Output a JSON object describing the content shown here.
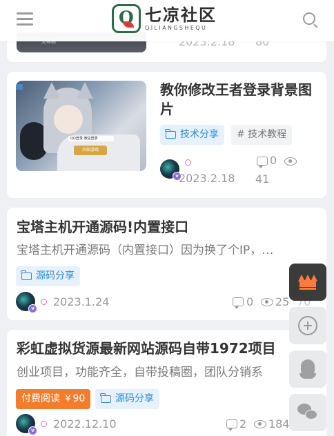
{
  "header": {
    "logo_title": "七凉社区",
    "logo_subtitle": "QILIANGSHEQU",
    "logo_letter": "Q"
  },
  "partial_post": {
    "thumb_text": "无标题",
    "date": "2023.2.18",
    "views": "80"
  },
  "posts": [
    {
      "title_line1": "教你修改王者登录背景图",
      "title_line2": "片",
      "tags": [
        "技术分享",
        "# 技术教程"
      ],
      "thumb_bar_text": "QQ登录  微信登录",
      "thumb_button_text": "开始游戏",
      "comments": "0",
      "date": "2023.2.18",
      "views": "41"
    },
    {
      "title": "宝塔主机开通源码!内置接口",
      "description": "宝塔主机开通源码（内置接口）因为换了个IP，…",
      "tags": [
        "源码分享"
      ],
      "date": "2023.1.24",
      "comments": "0",
      "views": "25",
      "extra": "70"
    },
    {
      "title": "彩虹虚拟货源最新网站源码自带1972项目",
      "description": "创业项目，功能齐全，自带投稿圈，团队分销系",
      "tags": [
        "付费阅读 ￥90",
        "源码分享"
      ],
      "date": "2022.12.10",
      "comments": "2",
      "views": "184"
    }
  ],
  "avatar_badge": "v",
  "colors": {
    "accent_blue": "#2d8ad6",
    "tag_orange": "#f57c2a",
    "logo_green": "#2f6a4b",
    "vip_orange": "#ff7a3d"
  },
  "icons": [
    "menu-icon",
    "search-icon",
    "folder-icon",
    "comment-icon",
    "eye-icon",
    "crown-icon",
    "add-circle-icon",
    "qq-icon",
    "wechat-icon"
  ]
}
